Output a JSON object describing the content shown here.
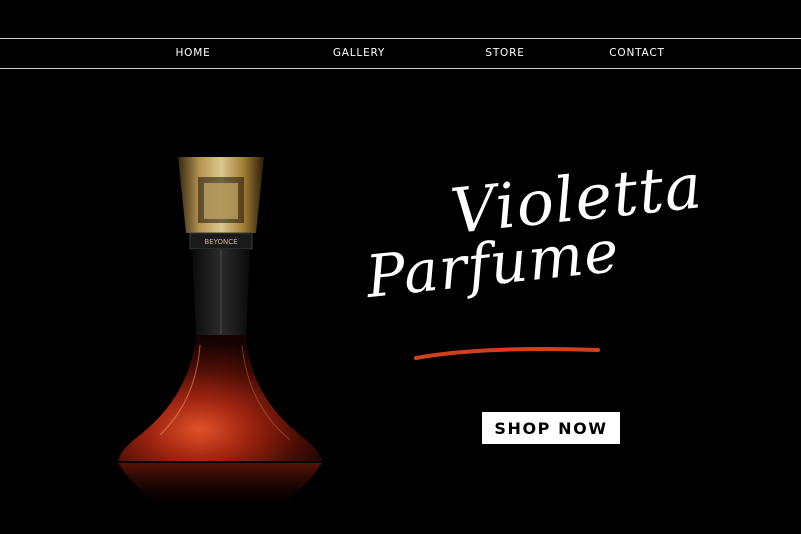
{
  "nav": {
    "items": [
      {
        "label": "HOME"
      },
      {
        "label": "GALLERY"
      },
      {
        "label": "STORE"
      },
      {
        "label": "CONTACT"
      }
    ]
  },
  "hero": {
    "title_line1": "Violetta",
    "title_line2": "Parfume",
    "bottle_label": "BEYONCÉ",
    "cta_label": "SHOP NOW"
  },
  "colors": {
    "background": "#000000",
    "text": "#ffffff",
    "accent": "#d1401c",
    "button_bg": "#ffffff",
    "button_text": "#000000"
  }
}
